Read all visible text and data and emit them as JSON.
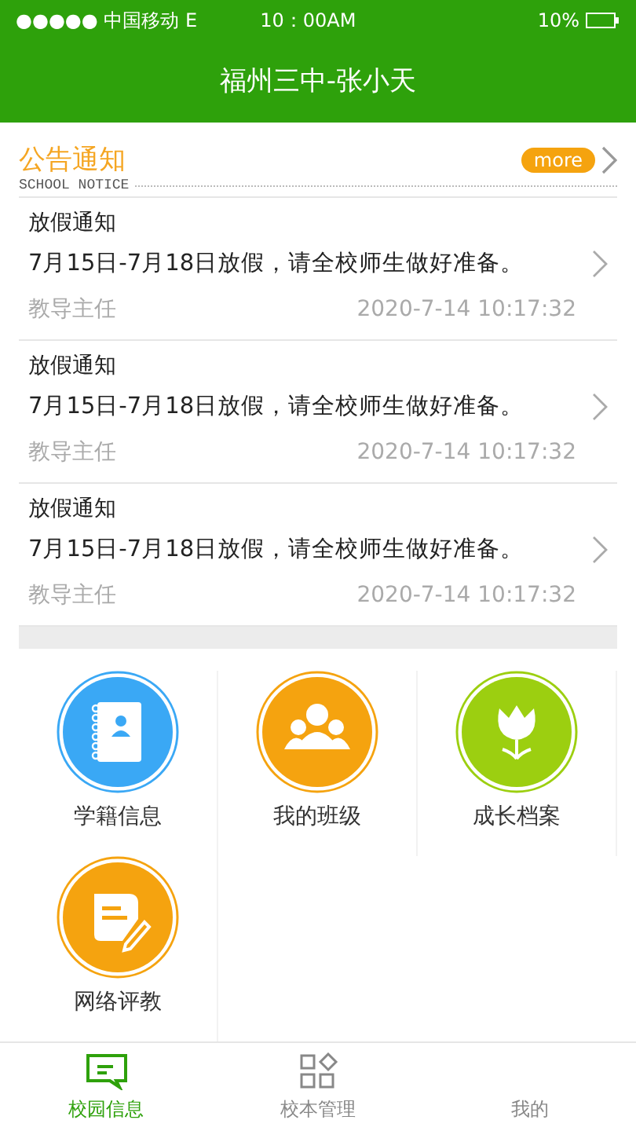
{
  "status_bar": {
    "carrier": "●●●●● 中国移动 E",
    "time": "10：00AM",
    "battery": "10%"
  },
  "header": {
    "title": "福州三中-张小天"
  },
  "notice": {
    "title": "公告通知",
    "subtitle": "SCHOOL NOTICE",
    "more": "more",
    "items": [
      {
        "title": "放假通知",
        "body": "7月15日-7月18日放假，请全校师生做好准备。",
        "author": "教导主任",
        "time": "2020-7-14 10:17:32"
      },
      {
        "title": "放假通知",
        "body": "7月15日-7月18日放假，请全校师生做好准备。",
        "author": "教导主任",
        "time": "2020-7-14 10:17:32"
      },
      {
        "title": "放假通知",
        "body": "7月15日-7月18日放假，请全校师生做好准备。",
        "author": "教导主任",
        "time": "2020-7-14 10:17:32"
      }
    ]
  },
  "modules": [
    {
      "kind": "book",
      "label": "学籍信息",
      "color": "#3aa8f5"
    },
    {
      "kind": "group",
      "label": "我的班级",
      "color": "#f5a30f"
    },
    {
      "kind": "flower",
      "label": "成长档案",
      "color": "#9ccf10"
    },
    {
      "kind": "note",
      "label": "网络评教",
      "color": "#f5a30f"
    }
  ],
  "tabs": [
    {
      "kind": "message",
      "label": "校园信息",
      "selected": true
    },
    {
      "kind": "grid",
      "label": "校本管理",
      "selected": false
    },
    {
      "kind": "none",
      "label": "我的",
      "selected": false
    }
  ]
}
